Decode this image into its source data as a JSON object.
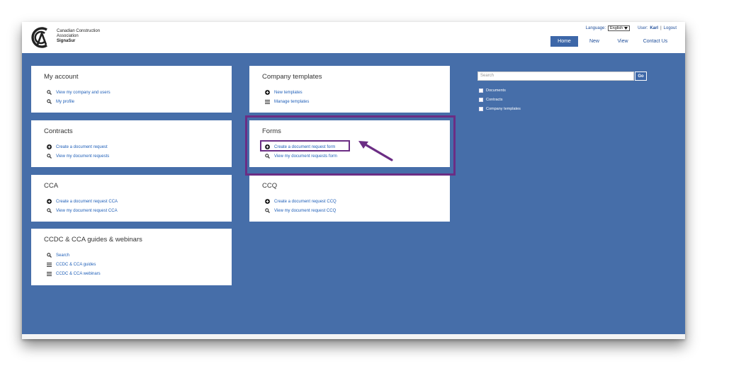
{
  "brand": {
    "line1": "Canadian Construction",
    "line2": "Association",
    "line3": "SignaSur"
  },
  "topbar": {
    "language_label": "Language:",
    "language_value": "English",
    "user_label": "User:",
    "user_name": "Karl",
    "separator": "|",
    "logout": "Logout"
  },
  "nav": {
    "home": "Home",
    "new": "New",
    "view": "View",
    "contact": "Contact Us"
  },
  "cards": {
    "my_account": {
      "title": "My account",
      "links": [
        {
          "label": "View my company and users",
          "icon": "search-icon"
        },
        {
          "label": "My profile",
          "icon": "search-icon"
        }
      ]
    },
    "company_templates": {
      "title": "Company templates",
      "links": [
        {
          "label": "New templates",
          "icon": "plus-circle-icon"
        },
        {
          "label": "Manage templates",
          "icon": "list-icon"
        }
      ]
    },
    "contracts": {
      "title": "Contracts",
      "links": [
        {
          "label": "Create a document request",
          "icon": "plus-circle-icon"
        },
        {
          "label": "View my document requests",
          "icon": "search-icon"
        }
      ]
    },
    "forms": {
      "title": "Forms",
      "links": [
        {
          "label": "Create a document request form",
          "icon": "plus-circle-icon"
        },
        {
          "label": "View my document requests form",
          "icon": "search-icon"
        }
      ]
    },
    "cca": {
      "title": "CCA",
      "links": [
        {
          "label": "Create a document request CCA",
          "icon": "plus-circle-icon"
        },
        {
          "label": "View my document request CCA",
          "icon": "search-icon"
        }
      ]
    },
    "ccq": {
      "title": "CCQ",
      "links": [
        {
          "label": "Create a document request CCQ",
          "icon": "plus-circle-icon"
        },
        {
          "label": "View my document request CCQ",
          "icon": "search-icon"
        }
      ]
    },
    "guides": {
      "title": "CCDC & CCA guides & webinars",
      "links": [
        {
          "label": "Search",
          "icon": "search-icon"
        },
        {
          "label": "CCDC & CCA guides",
          "icon": "list-icon"
        },
        {
          "label": "CCDC & CCA webinars",
          "icon": "list-icon"
        }
      ]
    }
  },
  "search": {
    "placeholder": "Search",
    "go": "Go",
    "filters": [
      "Documents",
      "Contracts",
      "Company templates"
    ]
  },
  "colors": {
    "main_bg": "#466ea9",
    "nav_active": "#3d67a8",
    "link": "#1f5fb8",
    "highlight": "#6b2d84"
  }
}
